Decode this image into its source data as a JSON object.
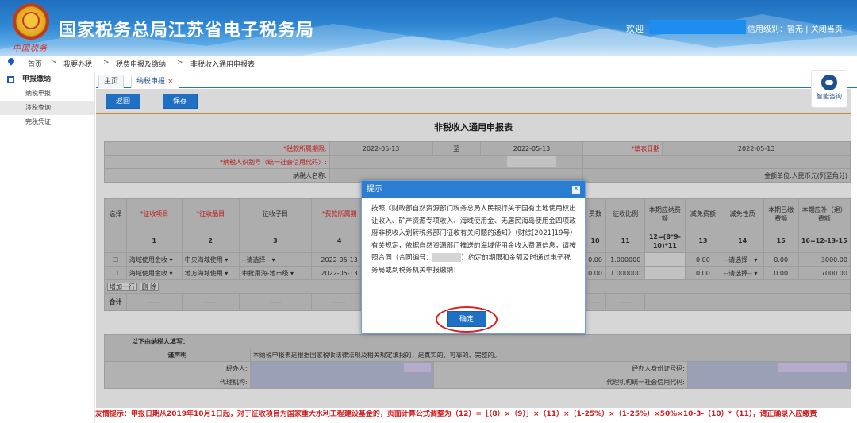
{
  "header": {
    "site_title": "国家税务总局江苏省电子税务局",
    "logo_text": "中国税务",
    "welcome": "欢迎",
    "credit_text": "信用级别：暂无 | 关闭当页"
  },
  "breadcrumb": [
    "首页",
    "我要办税",
    "税费申报及缴纳",
    "非税收入通用申报表"
  ],
  "breadcrumb_sep": ">",
  "sidebar": {
    "title": "申报缴纳",
    "items": [
      {
        "label": "纳税申报",
        "active": false
      },
      {
        "label": "涉税查询",
        "active": true
      },
      {
        "label": "完税凭证",
        "active": false
      }
    ]
  },
  "tabs": [
    {
      "label": "主页"
    },
    {
      "label": "纳税申报",
      "close": "×"
    }
  ],
  "toolbar": {
    "back": "返回",
    "save": "保存"
  },
  "form": {
    "title": "非税收入通用申报表",
    "period_label": "*税款所属期限:",
    "period_from": "2022-05-13",
    "period_to_label": "至",
    "period_to": "2022-05-13",
    "fill_date_label": "*填表日期",
    "fill_date": "2022-05-13",
    "taxpayer_id_label": "*纳税人识别号（统一社会信用代码）:",
    "taxpayer_name_label": "纳税人名称:",
    "unit": "金额单位:人民币元(列至角分)"
  },
  "table": {
    "left_headers": [
      "选择",
      "*征收项目",
      "*征收品目",
      "征收子目",
      "*费款所属期"
    ],
    "left_nums": [
      "",
      "1",
      "2",
      "3",
      "4"
    ],
    "right_headers": [
      "费数",
      "征收比例",
      "本期应纳费额",
      "减免费额",
      "减免性质",
      "本期已缴费额",
      "本期应补（退）费额"
    ],
    "right_nums": [
      "10",
      "11",
      "12=(8*9-10)*11",
      "13",
      "14",
      "15",
      "16=12-13-15"
    ],
    "rows": [
      {
        "item": "海域使用金收",
        "sub_item": "中央海域使用",
        "child": "--请选择--",
        "period": "2022-05-13",
        "fee": "0.00",
        "ratio": "1.000000",
        "reduce": "0.00",
        "nature": "--请选择--",
        "paid": "0.00",
        "due": "3000.00"
      },
      {
        "item": "海域使用金收",
        "sub_item": "地方海域使用",
        "child": "审批用海-地市级",
        "period": "2022-05-13",
        "fee": "0.00",
        "ratio": "1.000000",
        "reduce": "0.00",
        "nature": "--请选择--",
        "paid": "0.00",
        "due": "7000.00"
      }
    ],
    "add_row": "增加一行",
    "delete_row": "删 除",
    "total_label": "合计",
    "dash": "——"
  },
  "declaration": {
    "section_label": "以下由纳税人填写：",
    "statement_label": "谨声明",
    "statement": "本纳税申报表是根据国家税收法律法规及相关规定填报的，是真实的、可靠的、完整的。",
    "agent_label": "经办人:",
    "agent_id_label": "经办人身份证号码:",
    "agency_label": "代理机构:",
    "agency_code_label": "代理机构统一社会信用代码:"
  },
  "modal": {
    "title": "提示",
    "close": "×",
    "body_before": "按照《财政部自然资源部门税务总局人民银行关于国有土地使用权出让收入、矿产资源专项收入、海域使用金、无居民海岛使用金四项政府非税收入划转税务部门征收有关问题的通知》（财综[2021]19号）有关规定，依据自然资源部门推送的海域使用金收入费源信息，请按照合同（合同编号：",
    "body_after": "）约定的期限和金额及时通过电子税务局或到税务机关申报缴纳！",
    "ok": "确定"
  },
  "consult": {
    "label": "智能咨询"
  },
  "tip": "友情提示：申报日期从2019年10月1日起，对于征收项目为国家重大水利工程建设基金的，页面计算公式调整为（12）=［（8）×（9）］×（11）×（1-25%）×（1-25%）×50%×10-3-（10）*（11），请正确录入应缴费",
  "colors": {
    "header_blue": "#2e86d3",
    "button_blue": "#1f6fc4",
    "tip_red": "#d01c1c",
    "ring_red": "#e0201c"
  }
}
